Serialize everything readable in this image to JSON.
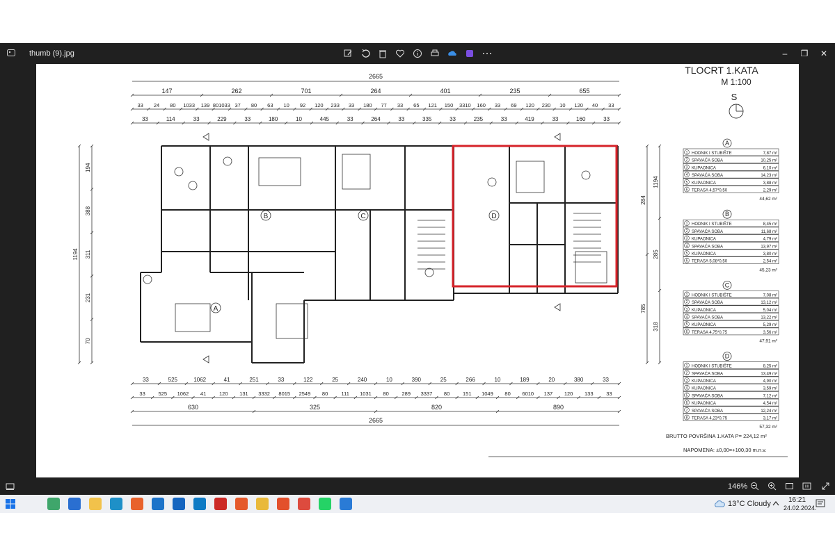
{
  "window": {
    "title": "thumb (9).jpg"
  },
  "toolbar": {
    "icons": [
      "edit-icon",
      "rotate-icon",
      "delete-icon",
      "favorite-icon",
      "info-icon",
      "print-icon",
      "onedrive-icon",
      "clipchamp-icon",
      "more-icon"
    ]
  },
  "window_controls": {
    "minimize": "–",
    "maximize": "❐",
    "close": "✕"
  },
  "plan": {
    "title": "TLOCRT 1.KATA",
    "scale": "M 1:100",
    "north": "S",
    "top_total": "2665",
    "top_dims": [
      "147",
      "262",
      "701",
      "264",
      "401",
      "235",
      "655"
    ],
    "top_row2": [
      "33",
      "24",
      "80",
      "1033",
      "139",
      "801033",
      "37",
      "80",
      "63",
      "10",
      "92",
      "120",
      "233",
      "33",
      "180",
      "77",
      "33",
      "65",
      "121",
      "150",
      "3310",
      "160",
      "33",
      "69",
      "120",
      "230",
      "10",
      "120",
      "40",
      "33"
    ],
    "top_row3": [
      "33",
      "114",
      "33",
      "229",
      "33",
      "180",
      "10",
      "445",
      "33",
      "264",
      "33",
      "335",
      "33",
      "235",
      "33",
      "419",
      "33",
      "160",
      "33"
    ],
    "bottom_row1": [
      "33",
      "525",
      "1062",
      "41",
      "251",
      "33",
      "122",
      "25",
      "240",
      "10",
      "390",
      "25",
      "266",
      "10",
      "189",
      "20",
      "380",
      "33"
    ],
    "bottom_row2": [
      "33",
      "525",
      "1062",
      "41",
      "120",
      "131",
      "3332",
      "8015",
      "2549",
      "80",
      "111",
      "1031",
      "80",
      "289",
      "3337",
      "80",
      "151",
      "1049",
      "80",
      "6010",
      "137",
      "120",
      "133",
      "33"
    ],
    "bottom_row3": [
      "630",
      "325",
      "820",
      "890"
    ],
    "bottom_total": "2665",
    "left_dims": [
      "1194",
      "194",
      "388",
      "311",
      "231",
      "70"
    ],
    "right_dims": [
      "284",
      "785",
      "1194",
      "285",
      "318"
    ],
    "apartments": [
      {
        "letter": "A",
        "rooms": [
          {
            "n": "1",
            "name": "HODNIK I STUBIŠTE",
            "area": "7,87 m²"
          },
          {
            "n": "2",
            "name": "SPAVAĆA SOBA",
            "area": "10,25 m²"
          },
          {
            "n": "3",
            "name": "KUPAONICA",
            "area": "6,10 m²"
          },
          {
            "n": "4",
            "name": "SPAVAĆA SOBA",
            "area": "14,23 m²"
          },
          {
            "n": "5",
            "name": "KUPAONICA",
            "area": "3,88 m²"
          },
          {
            "n": "6",
            "name": "TERASA 4,57*0,50",
            "area": "2,29 m²"
          }
        ],
        "total": "44,62 m²"
      },
      {
        "letter": "B",
        "rooms": [
          {
            "n": "1",
            "name": "HODNIK I STUBIŠTE",
            "area": "8,45 m²"
          },
          {
            "n": "2",
            "name": "SPAVAĆA SOBA",
            "area": "11,68 m²"
          },
          {
            "n": "3",
            "name": "KUPAONICA",
            "area": "4,79 m²"
          },
          {
            "n": "4",
            "name": "SPAVAĆA SOBA",
            "area": "13,97 m²"
          },
          {
            "n": "5",
            "name": "KUPAONICA",
            "area": "3,80 m²"
          },
          {
            "n": "6",
            "name": "TERASA 5,08*0,50",
            "area": "2,54 m²"
          }
        ],
        "total": "45,23 m²"
      },
      {
        "letter": "C",
        "rooms": [
          {
            "n": "1",
            "name": "HODNIK I STUBIŠTE",
            "area": "7,08 m²"
          },
          {
            "n": "2",
            "name": "SPAVAĆA SOBA",
            "area": "13,12 m²"
          },
          {
            "n": "3",
            "name": "KUPAONICA",
            "area": "5,04 m²"
          },
          {
            "n": "4",
            "name": "SPAVAĆA SOBA",
            "area": "13,22 m²"
          },
          {
            "n": "5",
            "name": "KUPAONICA",
            "area": "5,29 m²"
          },
          {
            "n": "6",
            "name": "TERASA 4,75*0,75",
            "area": "3,56 m²"
          }
        ],
        "total": "47,91 m²"
      },
      {
        "letter": "D",
        "rooms": [
          {
            "n": "1",
            "name": "HODNIK I STUBIŠTE",
            "area": "8,25 m²"
          },
          {
            "n": "2",
            "name": "SPAVAĆA SOBA",
            "area": "13,49 m²"
          },
          {
            "n": "3",
            "name": "KUPAONICA",
            "area": "4,90 m²"
          },
          {
            "n": "4",
            "name": "KUPAONICA",
            "area": "3,59 m²"
          },
          {
            "n": "5",
            "name": "SPAVAĆA SOBA",
            "area": "7,12 m²"
          },
          {
            "n": "6",
            "name": "KUPAONICA",
            "area": "4,54 m²"
          },
          {
            "n": "7",
            "name": "SPAVAĆA SOBA",
            "area": "12,24 m²"
          },
          {
            "n": "8",
            "name": "TERASA 4,23*0,75",
            "area": "3,17 m²"
          }
        ],
        "total": "57,32 m²"
      }
    ],
    "brutto": "BRUTTO POVRŠINA 1.KATA   P= 224,12 m²",
    "napomena": "NAPOMENA: ±0,00=+100,30 m.n.v.",
    "apartment_labels": [
      "A",
      "B",
      "C",
      "D"
    ],
    "highlight_color": "#d6232a"
  },
  "status": {
    "zoom": "146%"
  },
  "taskbar": {
    "apps": [
      {
        "name": "copilot-icon",
        "color": "#3fa66b"
      },
      {
        "name": "store-icon",
        "color": "#2a6fd1"
      },
      {
        "name": "explorer-icon",
        "color": "#f2c24b"
      },
      {
        "name": "edge-legacy-icon",
        "color": "#1e90c8"
      },
      {
        "name": "firefox-icon",
        "color": "#e8622c"
      },
      {
        "name": "media-player-icon",
        "color": "#1c73c9"
      },
      {
        "name": "photos-icon",
        "color": "#1565c0"
      },
      {
        "name": "edge-icon",
        "color": "#0f7bc4"
      },
      {
        "name": "acrobat-icon",
        "color": "#cc2a26"
      },
      {
        "name": "paint-icon",
        "color": "#e55a2c"
      },
      {
        "name": "files-icon",
        "color": "#e9b93a"
      },
      {
        "name": "office-icon",
        "color": "#e3502c"
      },
      {
        "name": "chrome-icon",
        "color": "#dd4b3e"
      },
      {
        "name": "whatsapp-icon",
        "color": "#25d366"
      },
      {
        "name": "editor-icon",
        "color": "#2a7bd6"
      }
    ],
    "weather": "13°C  Cloudy",
    "time": "16:21",
    "date": "24.02.2024."
  }
}
